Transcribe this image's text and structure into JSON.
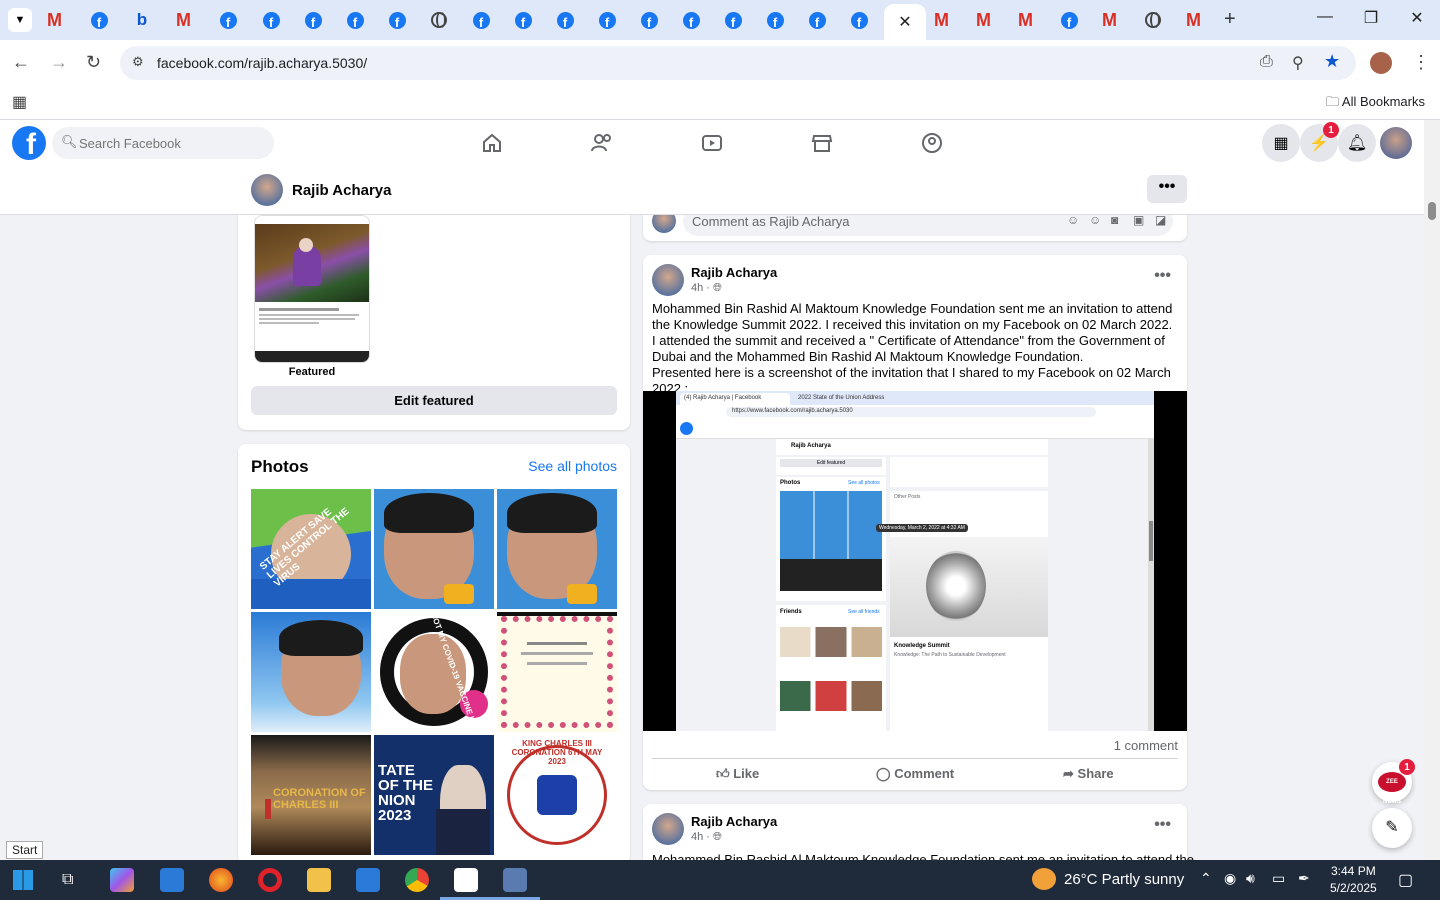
{
  "browser": {
    "url": "facebook.com/rajib.acharya.5030/",
    "all_bookmarks": "All Bookmarks"
  },
  "fb": {
    "search_placeholder": "Search Facebook",
    "notifications_badge": "1",
    "messenger_badge": "1"
  },
  "profile": {
    "name": "Rajib Acharya"
  },
  "featured": {
    "label": "Featured",
    "edit_button": "Edit featured"
  },
  "photos": {
    "title": "Photos",
    "see_all": "See all photos",
    "items": [
      {
        "caption": "STAY ALERT  SAVE LIVES  CONTROL THE VIRUS"
      },
      {
        "caption": ""
      },
      {
        "caption": ""
      },
      {
        "caption": ""
      },
      {
        "caption": "I GOT MY COVID-19 VACCINE  UNICEF"
      },
      {
        "caption": ""
      },
      {
        "caption": "CORONATION OF CHARLES III"
      },
      {
        "caption": "TATE OF THE NION 2023"
      },
      {
        "caption": "KING CHARLES III CORONATION 6TH MAY 2023"
      }
    ]
  },
  "comment_box": {
    "placeholder": "Comment as Rajib Acharya"
  },
  "post1": {
    "author": "Rajib Acharya",
    "time": "4h · ",
    "text": "Mohammed Bin Rashid Al Maktoum Knowledge Foundation sent me an invitation to attend the Knowledge Summit 2022. I received this invitation on my Facebook on 02 March 2022.\nI attended the summit and received a \" Certificate of Attendance\" from the Government of Dubai and the   Mohammed Bin Rashid Al Maktoum Knowledge Foundation.\nPresented here is a screenshot of  the invitation that I shared to my Facebook on 02 March 2022 :",
    "comment_count": "1 comment",
    "like": "Like",
    "comment": "Comment",
    "share": "Share",
    "screenshot": {
      "url": "https://www.facebook.com/rajib.acharya.5030",
      "tab1": "(4) Rajib Acharya | Facebook",
      "tab2": "2022 State of the Union Address",
      "author": "Rajib Acharya",
      "tooltip": "Wednesday, March 2, 2022 at 4:32 AM",
      "event_title": "Knowledge Summit",
      "event_sub": "Knowledge: The Path to Sustainable Development",
      "photos_label": "Photos",
      "friends_label": "Friends",
      "see_all_photos": "See all photos",
      "see_all_friends": "See all friends",
      "edit_featured": "Edit featured",
      "other_posts": "Other Posts"
    }
  },
  "post2": {
    "author": "Rajib Acharya",
    "time": "4h · ",
    "text": "Mohammed Bin Rashid Al Maktoum Knowledge Foundation sent me an invitation to attend the"
  },
  "floating": {
    "news_badge": "1",
    "news_label": "ZEE NEWS"
  },
  "taskbar": {
    "start_tooltip": "Start",
    "weather": "26°C  Partly sunny",
    "time": "3:44 PM",
    "date": "5/2/2025"
  }
}
